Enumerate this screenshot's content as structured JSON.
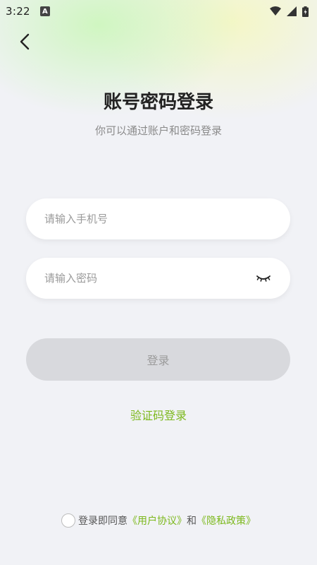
{
  "status_bar": {
    "time": "3:22",
    "notification_badge": "A",
    "icons": [
      "wifi-icon",
      "signal-icon",
      "battery-icon"
    ]
  },
  "header": {
    "back_icon": "chevron-left-icon",
    "title": "账号密码登录",
    "subtitle": "你可以通过账户和密码登录"
  },
  "form": {
    "phone_placeholder": "请输入手机号",
    "phone_value": "",
    "password_placeholder": "请输入密码",
    "password_value": "",
    "password_toggle_icon": "eye-closed-icon",
    "login_label": "登录"
  },
  "alt_login": {
    "code_login_label": "验证码登录"
  },
  "agreement": {
    "checked": false,
    "prefix": "登录即同意",
    "user_agreement": "《用户协议》",
    "conjunction": "和",
    "privacy_policy": "《隐私政策》"
  },
  "colors": {
    "accent": "#7cb81c",
    "background": "#f1f2f6",
    "button_disabled": "#d8d9dd"
  }
}
